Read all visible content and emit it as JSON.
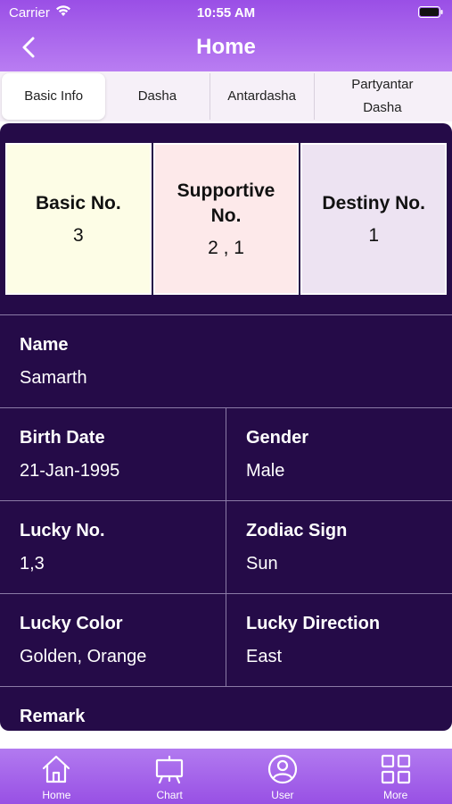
{
  "status": {
    "carrier": "Carrier",
    "time": "10:55 AM"
  },
  "nav": {
    "title": "Home"
  },
  "tabs": [
    {
      "label": "Basic Info",
      "active": true
    },
    {
      "label": "Dasha"
    },
    {
      "label": "Antardasha"
    },
    {
      "label": "Partyantar Dasha"
    }
  ],
  "cards": {
    "basic": {
      "title": "Basic No.",
      "value": "3",
      "color": "#fdfde6"
    },
    "supportive": {
      "title": "Supportive No.",
      "value": "2 , 1",
      "color": "#fde9ea"
    },
    "destiny": {
      "title": "Destiny No.",
      "value": "1",
      "color": "#ede3f2"
    }
  },
  "details": {
    "name": {
      "label": "Name",
      "value": "Samarth"
    },
    "birth_date": {
      "label": "Birth Date",
      "value": "21-Jan-1995"
    },
    "gender": {
      "label": "Gender",
      "value": "Male"
    },
    "lucky_no": {
      "label": "Lucky No.",
      "value": "1,3"
    },
    "zodiac": {
      "label": "Zodiac Sign",
      "value": "Sun"
    },
    "lucky_color": {
      "label": "Lucky Color",
      "value": "Golden, Orange"
    },
    "lucky_direction": {
      "label": "Lucky Direction",
      "value": "East"
    },
    "remark": {
      "label": "Remark"
    }
  },
  "bottom_nav": [
    {
      "label": "Home",
      "icon": "home-icon"
    },
    {
      "label": "Chart",
      "icon": "chart-board-icon"
    },
    {
      "label": "User",
      "icon": "user-icon"
    },
    {
      "label": "More",
      "icon": "grid-icon"
    }
  ],
  "colors": {
    "header": "#9a4fe6",
    "panel": "#250b48",
    "accent": "#b27af0"
  }
}
